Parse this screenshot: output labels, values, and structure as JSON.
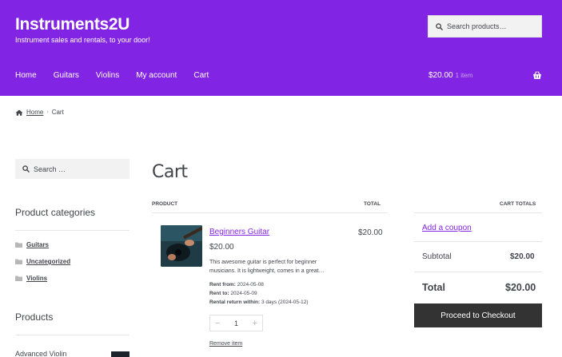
{
  "site": {
    "title": "Instruments2U",
    "tagline": "Instrument sales and rentals, to your door!"
  },
  "colors": {
    "accent": "#8224e3",
    "button": "#333333"
  },
  "header_search": {
    "placeholder": "Search products…"
  },
  "nav": {
    "items": [
      "Home",
      "Guitars",
      "Violins",
      "My account",
      "Cart"
    ]
  },
  "header_cart": {
    "amount": "$20.00",
    "count": "1 item",
    "icon": "basket-icon"
  },
  "breadcrumb": {
    "home": "Home",
    "separator": "›",
    "current": "Cart"
  },
  "sidebar": {
    "search_placeholder": "Search …",
    "categories_heading": "Product categories",
    "categories": [
      "Guitars",
      "Uncategorized",
      "Violins"
    ],
    "products_heading": "Products",
    "products": [
      "Advanced Violin"
    ]
  },
  "cart": {
    "title": "Cart",
    "col_product": "PRODUCT",
    "col_total": "TOTAL",
    "item": {
      "name": "Beginners Guitar",
      "price": "$20.00",
      "description": "This awesome guitar is perfect for beginner musicians. It is lightweight, comes in a great…",
      "rent_from_label": "Rent from:",
      "rent_from": "2024-05-08",
      "rent_to_label": "Rent to:",
      "rent_to": "2024-05-09",
      "return_label": "Rental return within:",
      "return_value": "3 days (2024-05-12)",
      "quantity": "1",
      "minus": "−",
      "plus": "+",
      "remove": "Remove item",
      "total": "$20.00"
    }
  },
  "totals": {
    "heading": "CART TOTALS",
    "coupon": "Add a coupon",
    "subtotal_label": "Subtotal",
    "subtotal": "$20.00",
    "total_label": "Total",
    "total": "$20.00",
    "checkout": "Proceed to Checkout"
  }
}
